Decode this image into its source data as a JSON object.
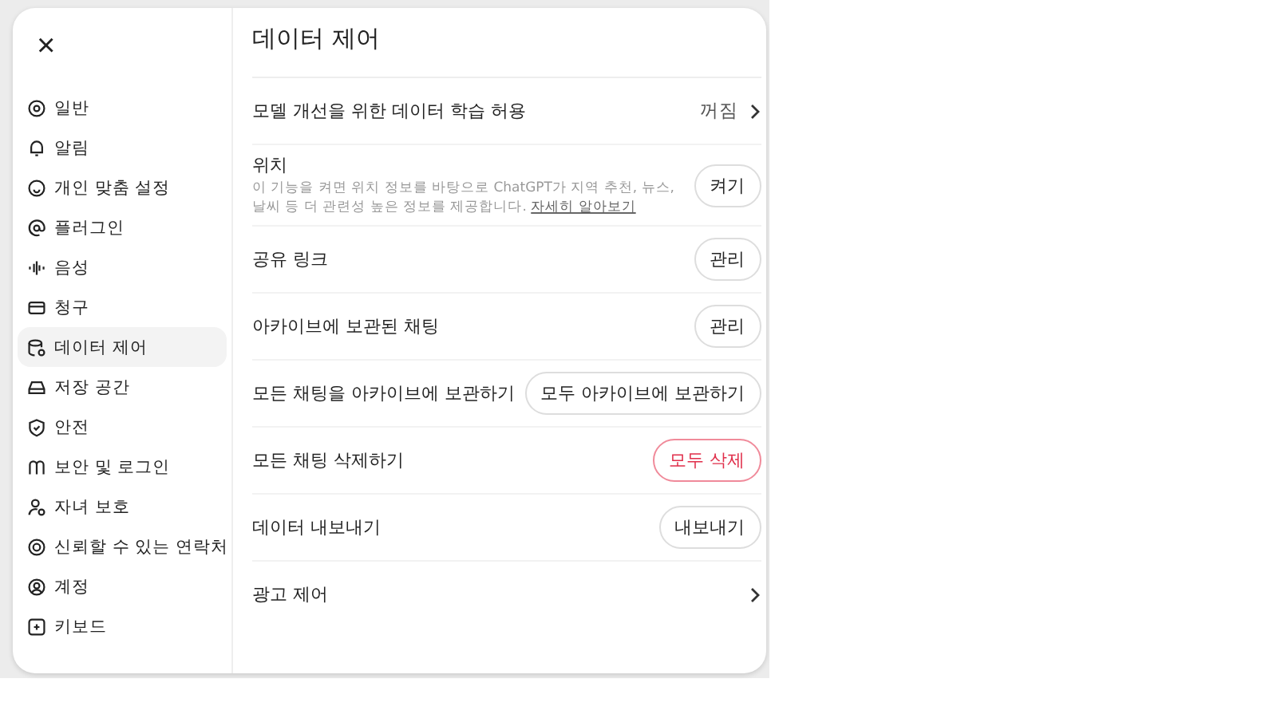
{
  "close_button": "×",
  "sidebar": {
    "items": [
      {
        "label": "일반",
        "selected": false
      },
      {
        "label": "알림",
        "selected": false
      },
      {
        "label": "개인 맞춤 설정",
        "selected": false
      },
      {
        "label": "플러그인",
        "selected": false
      },
      {
        "label": "음성",
        "selected": false
      },
      {
        "label": "청구",
        "selected": false
      },
      {
        "label": "데이터 제어",
        "selected": true
      },
      {
        "label": "저장 공간",
        "selected": false
      },
      {
        "label": "안전",
        "selected": false
      },
      {
        "label": "보안 및 로그인",
        "selected": false
      },
      {
        "label": "자녀 보호",
        "selected": false
      },
      {
        "label": "신뢰할 수 있는 연락처",
        "selected": false
      },
      {
        "label": "계정",
        "selected": false
      },
      {
        "label": "키보드",
        "selected": false
      }
    ]
  },
  "title": "데이터 제어",
  "settings": [
    {
      "kind": "value",
      "label": "모델 개선을 위한 데이터 학습 허용",
      "value": "꺼짐"
    },
    {
      "kind": "button",
      "label": "위치",
      "description": "이 기능을 켜면 위치 정보를 바탕으로 ChatGPT가 지역 추천, 뉴스, 날씨 등 더 관련성 높은 정보를 제공합니다.",
      "link": "자세히 알아보기",
      "button": "켜기",
      "danger": false
    },
    {
      "kind": "button",
      "label": "공유 링크",
      "button": "관리",
      "danger": false
    },
    {
      "kind": "button",
      "label": "아카이브에 보관된 채팅",
      "button": "관리",
      "danger": false
    },
    {
      "kind": "button",
      "label": "모든 채팅을 아카이브에 보관하기",
      "button": "모두 아카이브에 보관하기",
      "danger": false
    },
    {
      "kind": "button",
      "label": "모든 채팅 삭제하기",
      "button": "모두 삭제",
      "danger": true
    },
    {
      "kind": "button",
      "label": "데이터 내보내기",
      "button": "내보내기",
      "danger": false
    },
    {
      "kind": "link",
      "label": "광고 제어"
    }
  ]
}
